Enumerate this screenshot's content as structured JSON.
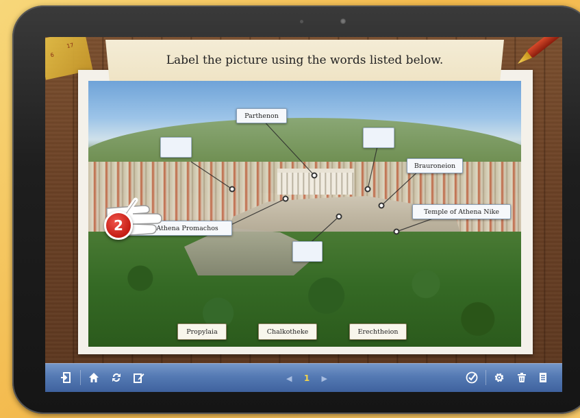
{
  "activity": {
    "instruction": "Label the picture using the words listed below.",
    "step_badge": "2"
  },
  "labels": {
    "parthenon": "Parthenon",
    "brauroneion": "Brauroneion",
    "temple_athena_nike": "Temple of Athena Nike",
    "statue_athena_promachos": "statue of Athena Promachos"
  },
  "word_bank": [
    {
      "label": "Propylaia"
    },
    {
      "label": "Chalkotheke"
    },
    {
      "label": "Erechtheion"
    }
  ],
  "ruler": {
    "mark_a": "6",
    "mark_b": "17"
  },
  "toolbar": {
    "left_icons": [
      "exit-icon",
      "home-icon",
      "refresh-icon",
      "edit-icon"
    ],
    "prev_arrow": "◀",
    "page_number": "1",
    "next_arrow": "▶",
    "right_icons": [
      "check-icon",
      "gear-icon",
      "trash-icon",
      "document-icon"
    ]
  },
  "colors": {
    "toolbar": "#5479b3",
    "page_number": "#f3d44a",
    "badge": "#d8261c",
    "banner": "#f4ecd6"
  }
}
